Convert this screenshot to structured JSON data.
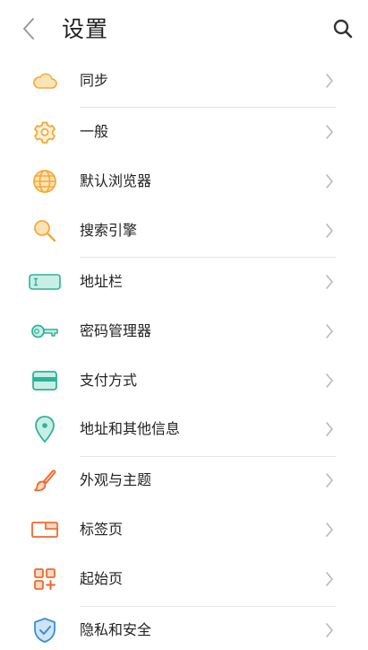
{
  "header": {
    "title": "设置"
  },
  "items": [
    {
      "label": "同步",
      "icon": "cloud-icon"
    },
    {
      "label": "一般",
      "icon": "gear-icon"
    },
    {
      "label": "默认浏览器",
      "icon": "globe-icon"
    },
    {
      "label": "搜索引擎",
      "icon": "magnifier-icon"
    },
    {
      "label": "地址栏",
      "icon": "address-bar-icon"
    },
    {
      "label": "密码管理器",
      "icon": "key-icon"
    },
    {
      "label": "支付方式",
      "icon": "credit-card-icon"
    },
    {
      "label": "地址和其他信息",
      "icon": "map-pin-icon"
    },
    {
      "label": "外观与主题",
      "icon": "paintbrush-icon"
    },
    {
      "label": "标签页",
      "icon": "tabs-icon"
    },
    {
      "label": "起始页",
      "icon": "grid-plus-icon"
    },
    {
      "label": "隐私和安全",
      "icon": "shield-check-icon"
    }
  ],
  "colors": {
    "orange": "#F4A93A",
    "teal": "#2DB39A",
    "coral": "#EE6A2C",
    "blue": "#3A8FD6",
    "chevron": "#b9b9b9"
  }
}
